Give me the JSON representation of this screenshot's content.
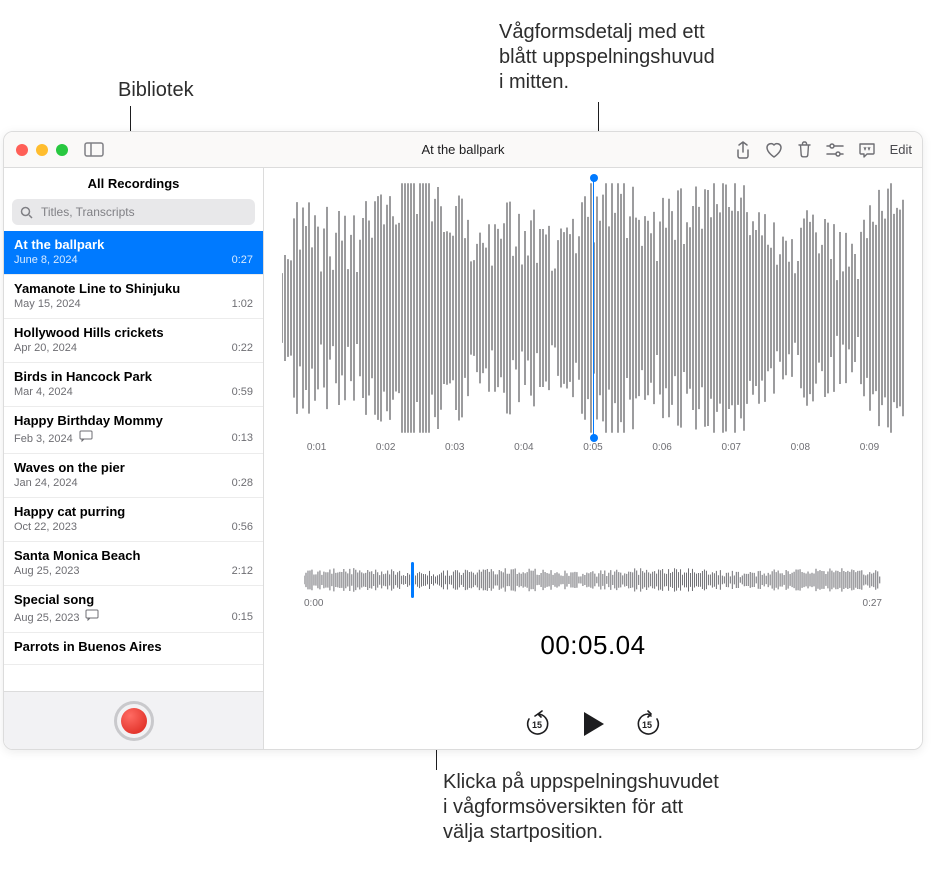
{
  "callouts": {
    "library": "Bibliotek",
    "waveform_detail": "Vågformsdetalj med ett\nblått uppspelningshuvud\ni mitten.",
    "overview_hint": "Klicka på uppspelningshuvudet\ni vågformsöversikten för att\nvälja startposition."
  },
  "window": {
    "title": "At the ballpark"
  },
  "toolbar": {
    "icons": {
      "sidebar_toggle": "sidebar-toggle-icon",
      "share": "share-icon",
      "favorite": "heart-icon",
      "delete": "trash-icon",
      "settings": "sliders-icon",
      "transcript": "transcript-icon"
    },
    "edit_label": "Edit"
  },
  "sidebar": {
    "header": "All Recordings",
    "search_placeholder": "Titles, Transcripts",
    "items": [
      {
        "title": "At the ballpark",
        "date": "June 8, 2024",
        "duration": "0:27",
        "selected": true
      },
      {
        "title": "Yamanote Line to Shinjuku",
        "date": "May 15, 2024",
        "duration": "1:02"
      },
      {
        "title": "Hollywood Hills crickets",
        "date": "Apr 20, 2024",
        "duration": "0:22"
      },
      {
        "title": "Birds in Hancock Park",
        "date": "Mar 4, 2024",
        "duration": "0:59"
      },
      {
        "title": "Happy Birthday Mommy",
        "date": "Feb 3, 2024",
        "duration": "0:13",
        "transcript": true
      },
      {
        "title": "Waves on the pier",
        "date": "Jan 24, 2024",
        "duration": "0:28"
      },
      {
        "title": "Happy cat purring",
        "date": "Oct 22, 2023",
        "duration": "0:56"
      },
      {
        "title": "Santa Monica Beach",
        "date": "Aug 25, 2023",
        "duration": "2:12"
      },
      {
        "title": "Special song",
        "date": "Aug 25, 2023",
        "duration": "0:15",
        "transcript": true
      },
      {
        "title": "Parrots in Buenos Aires",
        "date": "",
        "duration": ""
      }
    ]
  },
  "detail": {
    "ticks": [
      "0:01",
      "0:02",
      "0:03",
      "0:04",
      "0:05",
      "0:06",
      "0:07",
      "0:08",
      "0:09"
    ],
    "playhead_percent": 50
  },
  "overview": {
    "start": "0:00",
    "end": "0:27",
    "playhead_percent": 18.5
  },
  "clock": "00:05.04",
  "controls": {
    "back": "rewind-15-icon",
    "play": "play-icon",
    "forward": "forward-15-icon"
  }
}
